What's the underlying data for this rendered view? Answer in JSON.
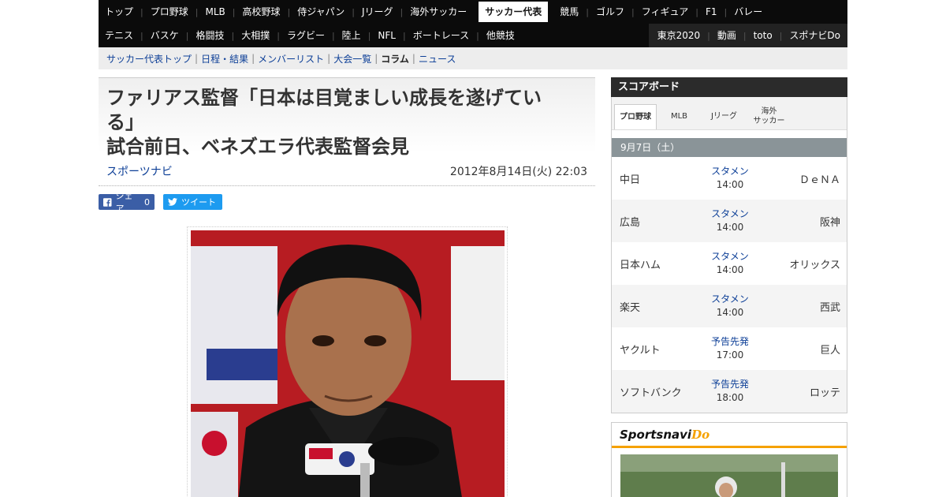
{
  "nav": {
    "row1": [
      "トップ",
      "プロ野球",
      "MLB",
      "高校野球",
      "侍ジャパン",
      "Jリーグ",
      "海外サッカー",
      "サッカー代表",
      "競馬",
      "ゴルフ",
      "フィギュア",
      "F1",
      "バレー"
    ],
    "row1_active": "サッカー代表",
    "row2": [
      "テニス",
      "バスケ",
      "格闘技",
      "大相撲",
      "ラグビー",
      "陸上",
      "NFL",
      "ボートレース",
      "他競技"
    ],
    "row2_right": [
      "東京2020",
      "動画",
      "toto",
      "スポナビDo"
    ]
  },
  "subnav": {
    "items": [
      "サッカー代表トップ",
      "日程・結果",
      "メンバーリスト",
      "大会一覧",
      "コラム",
      "ニュース"
    ],
    "current": "コラム"
  },
  "article": {
    "title_line1": "ファリアス監督「日本は目覚ましい成長を遂げてい",
    "title_line2": "る」",
    "title_line3": "試合前日、ベネズエラ代表監督会見",
    "source": "スポーツナビ",
    "date": "2012年8月14日(火) 22:03",
    "share_label": "シェア",
    "share_count": "0",
    "tweet_label": "ツイート"
  },
  "scoreboard": {
    "title": "スコアボード",
    "tabs": [
      "プロ野球",
      "MLB",
      "Jリーグ",
      "海外サッカー"
    ],
    "tabs_display": [
      "プロ野球",
      "MLB",
      "Jリーグ",
      "海外\nサッカー"
    ],
    "active_tab": "プロ野球",
    "date": "9月7日（土）",
    "games": [
      {
        "home": "中日",
        "away": "ＤｅＮＡ",
        "status": "スタメン",
        "time": "14:00"
      },
      {
        "home": "広島",
        "away": "阪神",
        "status": "スタメン",
        "time": "14:00"
      },
      {
        "home": "日本ハム",
        "away": "オリックス",
        "status": "スタメン",
        "time": "14:00"
      },
      {
        "home": "楽天",
        "away": "西武",
        "status": "スタメン",
        "time": "14:00"
      },
      {
        "home": "ヤクルト",
        "away": "巨人",
        "status": "予告先発",
        "time": "17:00"
      },
      {
        "home": "ソフトバンク",
        "away": "ロッテ",
        "status": "予告先発",
        "time": "18:00"
      }
    ]
  },
  "promo": {
    "logo_text": "Sportsnavi",
    "logo_accent": "Do"
  },
  "colors": {
    "nav_bg": "#0b0b0b",
    "link": "#0d3f97",
    "facebook": "#3b5ea6",
    "twitter": "#1d9bf0",
    "date_bar": "#8a9498",
    "promo_accent": "#f5a100"
  }
}
